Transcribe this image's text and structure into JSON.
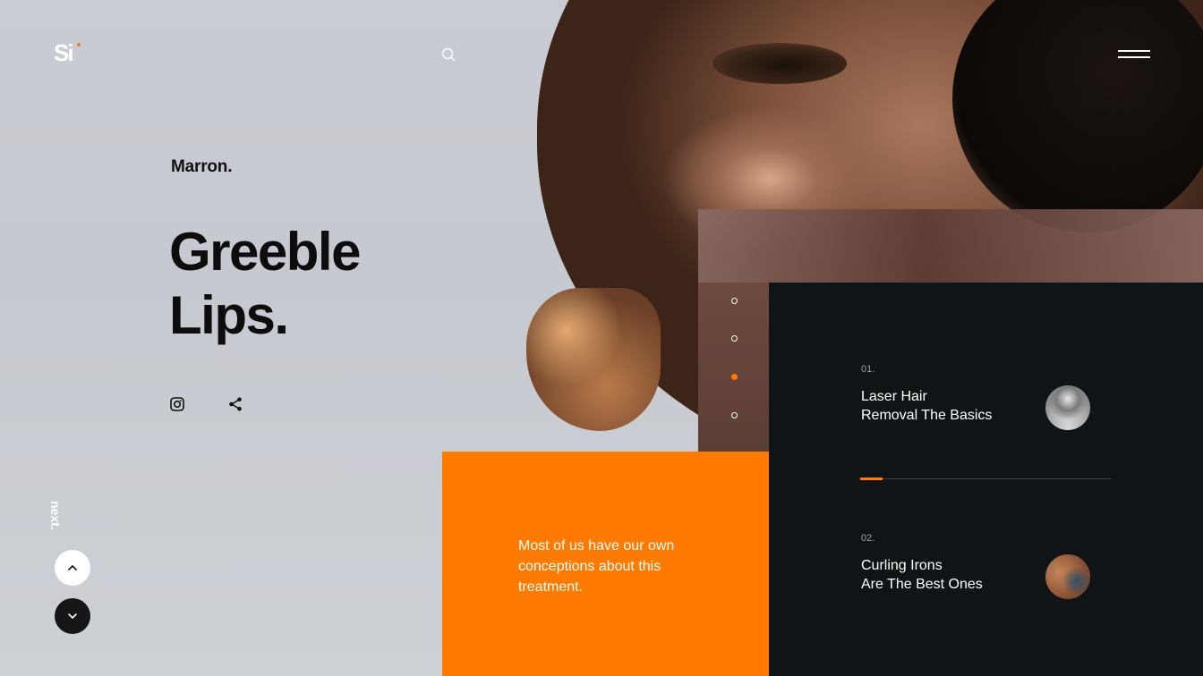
{
  "header": {
    "logo_text": "Si",
    "search_icon": "search-icon",
    "menu_icon": "hamburger-icon"
  },
  "hero": {
    "brand": "Marron.",
    "title_line1": "Greeble",
    "title_line2": "Lips.",
    "social": [
      "instagram-icon",
      "share-icon"
    ]
  },
  "side_nav": {
    "next_label": "next.",
    "up_icon": "chevron-up-icon",
    "down_icon": "chevron-down-icon"
  },
  "promo": {
    "text": "Most of us have our own conceptions about this treatment."
  },
  "slider": {
    "dot_count": 4,
    "active_index": 2
  },
  "posts": [
    {
      "number": "01.",
      "title_line1": "Laser Hair",
      "title_line2": "Removal The Basics"
    },
    {
      "number": "02.",
      "title_line1": "Curling Irons",
      "title_line2": "Are The Best Ones"
    }
  ],
  "progress": {
    "value": 0.09
  },
  "colors": {
    "accent": "#ff7a00",
    "dark": "#111416",
    "background": "#c9ccd2"
  }
}
